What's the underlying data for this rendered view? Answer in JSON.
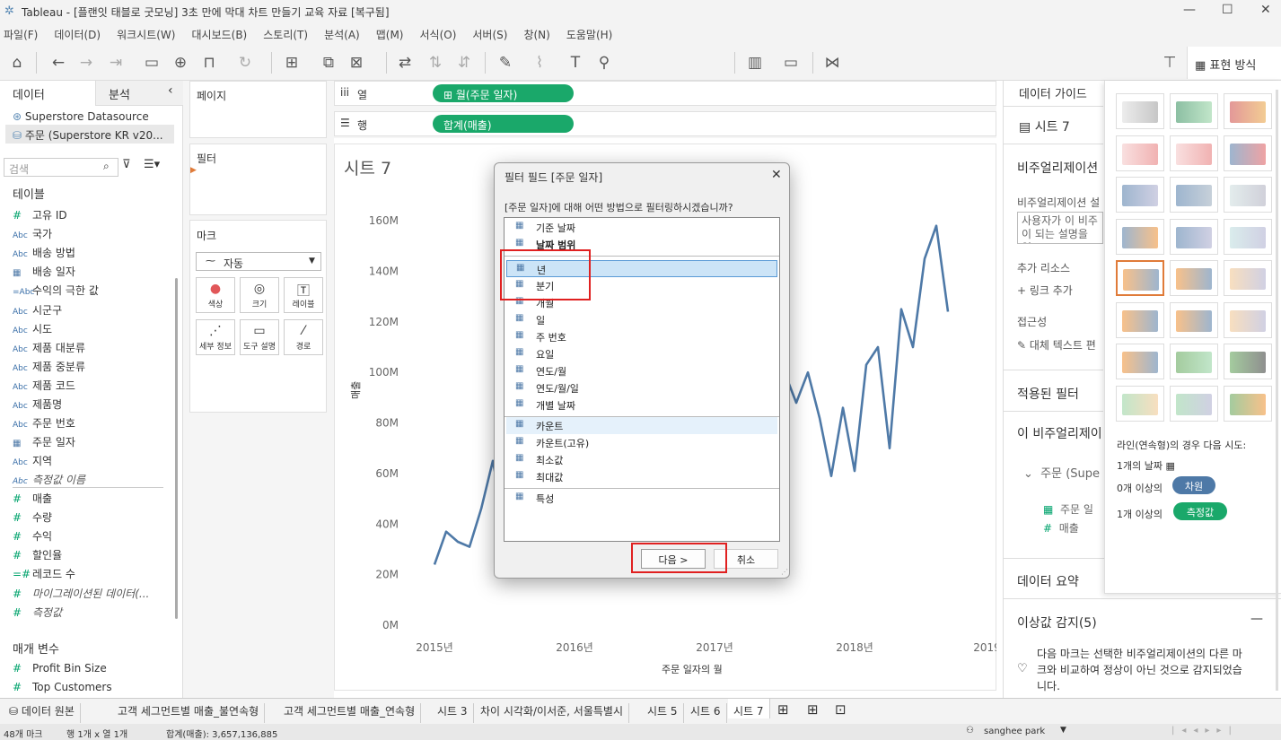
{
  "window": {
    "title": "Tableau - [플랜잇 태블로 굿모닝] 3초 만에 막대 차트 만들기 교육 자료 [복구됨]"
  },
  "menu": [
    "파일(F)",
    "데이터(D)",
    "워크시트(W)",
    "대시보드(B)",
    "스토리(T)",
    "분석(A)",
    "맵(M)",
    "서식(O)",
    "서버(S)",
    "창(N)",
    "도움말(H)"
  ],
  "toolbar": {
    "fit": "표준",
    "show_me": "표현 방식"
  },
  "left": {
    "tab_data": "데이터",
    "tab_analysis": "분석",
    "sources": [
      "Superstore Datasource",
      "주문 (Superstore KR v20..."
    ],
    "search_placeholder": "검색",
    "tables_header": "테이블",
    "fields": [
      {
        "t": "#",
        "name": "고유 ID"
      },
      {
        "t": "Abc",
        "name": "국가"
      },
      {
        "t": "Abc",
        "name": "배송 방법"
      },
      {
        "t": "cal",
        "name": "배송 일자"
      },
      {
        "t": "=Abc",
        "name": "수익의 극한 값"
      },
      {
        "t": "Abc",
        "name": "시군구"
      },
      {
        "t": "Abc",
        "name": "시도"
      },
      {
        "t": "Abc",
        "name": "제품 대분류"
      },
      {
        "t": "Abc",
        "name": "제품 중분류"
      },
      {
        "t": "Abc",
        "name": "제품 코드"
      },
      {
        "t": "Abc",
        "name": "제품명"
      },
      {
        "t": "Abc",
        "name": "주문 번호"
      },
      {
        "t": "cal",
        "name": "주문 일자"
      },
      {
        "t": "Abc",
        "name": "지역"
      },
      {
        "t": "Abc",
        "name": "측정값 이름",
        "italic": true
      }
    ],
    "measures": [
      {
        "t": "#",
        "name": "매출"
      },
      {
        "t": "#",
        "name": "수량"
      },
      {
        "t": "#",
        "name": "수익"
      },
      {
        "t": "#",
        "name": "할인율"
      },
      {
        "t": "=#",
        "name": "레코드 수"
      },
      {
        "t": "#",
        "name": "마이그레이션된 데이터(...",
        "italic": true
      },
      {
        "t": "#",
        "name": "측정값",
        "italic": true
      }
    ],
    "params_header": "매개 변수",
    "params": [
      {
        "t": "#",
        "name": "Profit Bin Size"
      },
      {
        "t": "#",
        "name": "Top Customers"
      }
    ]
  },
  "shelves": {
    "pages": "페이지",
    "filters": "필터",
    "marks": "마크",
    "mark_type": "자동",
    "mark_buttons": [
      "색상",
      "크기",
      "레이블",
      "세부 정보",
      "도구 설명",
      "경로"
    ],
    "columns_label": "열",
    "rows_label": "행",
    "columns_pill": "월(주문 일자)",
    "rows_pill": "합계(매출)"
  },
  "sheet": {
    "title": "시트 7",
    "y_axis_title": "매출",
    "x_axis_title": "주문 일자의 월"
  },
  "chart_data": {
    "type": "line",
    "title": "시트 7",
    "xlabel": "주문 일자의 월",
    "ylabel": "매출",
    "ylim": [
      0,
      165
    ],
    "y_ticks": [
      "0M",
      "20M",
      "40M",
      "60M",
      "80M",
      "100M",
      "120M",
      "140M",
      "160M"
    ],
    "x_ticks": [
      "2015년",
      "2016년",
      "2017년",
      "2018년",
      "2019년"
    ],
    "series": [
      {
        "values": [
          24,
          37,
          33,
          31,
          46,
          65,
          40,
          44,
          38,
          57,
          68,
          60,
          52,
          61,
          55,
          58,
          62,
          54,
          70,
          66,
          74,
          68,
          80,
          90,
          85,
          78,
          96,
          110,
          103,
          99,
          100,
          88,
          100,
          82,
          59,
          86,
          61,
          103,
          110,
          70,
          125,
          110,
          145,
          158,
          124
        ]
      }
    ],
    "visible_x_from_index": 35
  },
  "dialog": {
    "title": "필터 필드 [주문 일자]",
    "question": "[주문 일자]에 대해 어떤 방법으로 필터링하시겠습니까?",
    "group1": [
      "기준 날짜",
      "날짜 범위"
    ],
    "group2": [
      "년",
      "분기",
      "개월",
      "일",
      "주 번호",
      "요일",
      "연도/월",
      "연도/월/일",
      "개별 날짜"
    ],
    "group3": [
      "카운트",
      "카운트(고유)",
      "최소값",
      "최대값"
    ],
    "group4": [
      "특성"
    ],
    "next": "다음 >",
    "cancel": "취소"
  },
  "right": {
    "data_guide": "데이터 가이드",
    "sheet": "시트 7",
    "viz_desc": "비주얼리제이션",
    "viz_desc_sub": "비주얼리제이션 설",
    "desc_placeholder": [
      "사용자가 이 비주",
      "이 되는 설명을 입"
    ],
    "extra": "추가 리소스",
    "add_link": "링크 추가",
    "access": "접근성",
    "alt_text": "대체 텍스트 편",
    "applied_filters": "적용된 필터",
    "this_viz": "이 비주얼리제이",
    "order": "주문 (Supe",
    "order_date": "주문 일",
    "sales": "매출",
    "data_summary": "데이터 요약",
    "outliers": "이상값 감지(5)",
    "outliers_text": [
      "다음 마크는 선택한 비주얼리제이션의 다른 마",
      "크와 비교하여 정상이 아닌 것으로 감지되었습",
      "니다."
    ],
    "showme_hint": "라인(연속형)의 경우 다음 시도:",
    "hint1": "1개의 날짜",
    "hint2_pre": "0개 이상의",
    "hint2_badge": "차원",
    "hint3_pre": "1개 이상의",
    "hint3_badge": "측정값"
  },
  "tabs": [
    "데이터 원본",
    "고객 세그먼트별 매출_불연속형",
    "고객 세그먼트별 매출_연속형",
    "시트 3",
    "차이 시각화/이서준, 서울특별시",
    "시트 5",
    "시트 6",
    "시트 7"
  ],
  "status": {
    "marks": "48개 마크",
    "rows_cols": "행 1개 x 열 1개",
    "sum": "합계(매출): 3,657,136,885",
    "user": "sanghee park"
  },
  "colors": {
    "pill_green": "#1aa86a",
    "line_blue": "#4e79a7",
    "highlight_red": "#e02020",
    "badge_blue": "#4e79a7"
  }
}
